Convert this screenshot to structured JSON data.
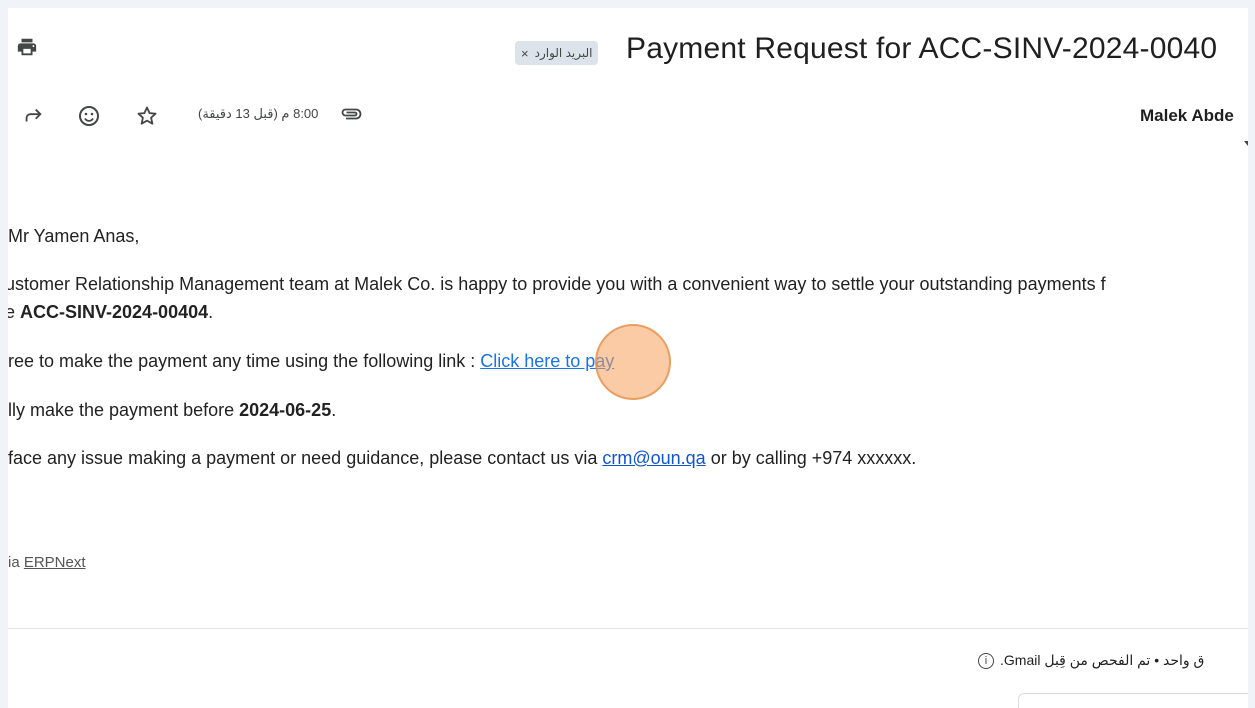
{
  "email": {
    "subject": "Payment Request for ACC-SINV-2024-0040",
    "label_chip": "البريد الوارد",
    "label_remove": "×",
    "sender": "Malek Abde",
    "time": "8:00 م (قبل 13 دقيقة)",
    "greeting": "Mr Yamen Anas,",
    "para1_line1": "ustomer Relationship Management team at Malek Co. is happy to provide you with a convenient way to settle your outstanding payments f",
    "para1_line2_prefix": "e ",
    "para1_invoice": "ACC-SINV-2024-00404",
    "para1_line2_suffix": ".",
    "para2_text": "ree to make the payment any time using the following link : ",
    "pay_link": "Click here to pay",
    "para3_text": "lly make the payment before ",
    "due_date": "2024-06-25",
    "para3_suffix": ".",
    "para4_text": "face any issue making a payment or need guidance, please contact us via ",
    "contact_email": "crm@oun.qa",
    "para4_suffix": " or by calling +974 xxxxxx.",
    "footer_prefix": "ia ",
    "footer_link": "ERPNext",
    "scan_text": "ق واحد  •  تم الفحص من قِبل Gmail.",
    "scan_info_glyph": "i"
  },
  "icons": {
    "print": "print-icon",
    "forward": "forward-icon",
    "emoji": "emoji-icon",
    "star": "star-icon",
    "attachment": "attachment-icon",
    "info": "info-icon"
  },
  "colors": {
    "background": "#f0f4f9",
    "card": "#ffffff",
    "link": "#1a73e8",
    "chip": "#dde3ea",
    "click_marker": "#f5a05a"
  }
}
